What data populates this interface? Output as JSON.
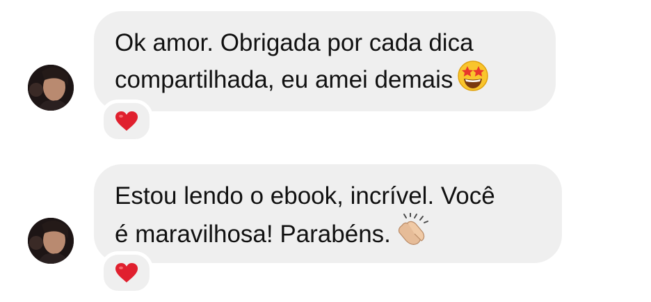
{
  "messages": [
    {
      "line1": "Ok amor. Obrigada por cada dica",
      "line2": "compartilhada, eu amei demais",
      "emoji": "star-struck-emoji",
      "reaction": "heart-emoji"
    },
    {
      "line1": "Estou lendo o ebook, incrível. Você",
      "line2": "é maravilhosa! Parabéns.",
      "emoji": "clapping-hands-emoji",
      "reaction": "heart-emoji"
    }
  ],
  "colors": {
    "bubble": "#efefef",
    "text": "#111111",
    "heart": "#e0202e"
  }
}
